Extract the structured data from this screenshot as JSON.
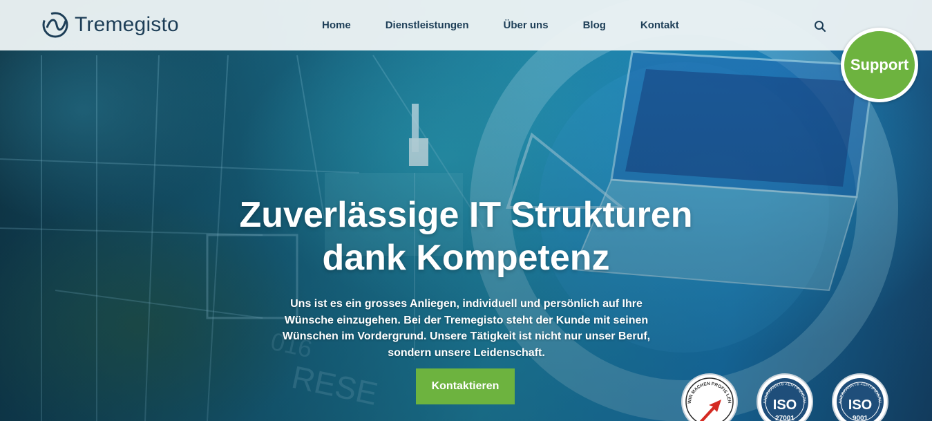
{
  "brand": {
    "name": "Tremegisto"
  },
  "nav": {
    "items": [
      {
        "label": "Home"
      },
      {
        "label": "Dienstleistungen"
      },
      {
        "label": "Über uns"
      },
      {
        "label": "Blog"
      },
      {
        "label": "Kontakt"
      }
    ],
    "search_icon": "search-icon"
  },
  "support": {
    "label": "Support"
  },
  "hero": {
    "headline_line1": "Zuverlässige IT Strukturen",
    "headline_line2": "dank Kompetenz",
    "lead": "Uns ist es ein grosses Anliegen, individuell und persönlich auf Ihre Wünsche einzugehen. Bei der Tremegisto steht der Kunde mit seinen Wünschen im Vordergrund. Unsere Tätigkeit ist nicht nur unser Beruf, sondern unsere Leidenschaft.",
    "cta_label": "Kontaktieren"
  },
  "seals": [
    {
      "name": "lehrbetrieb-seal",
      "ring_text": "WIR MACHEN PROFIS LEHRBETRIEB"
    },
    {
      "name": "iso-27001-seal",
      "ring_text": "ANERKANNTE ZERTIFIZIERUNGSSTELLE",
      "code": "ISO",
      "number": "27001"
    },
    {
      "name": "iso-9001-seal",
      "ring_text": "ANERKANNTE ZERTIFIZIERUNGSSTELLE",
      "code": "ISO",
      "number": "9001"
    }
  ],
  "colors": {
    "accent_green": "#6db33f",
    "nav_text": "#1d3e57",
    "header_bg": "#ecf2f4",
    "seal_blue": "#1f4e7a"
  }
}
